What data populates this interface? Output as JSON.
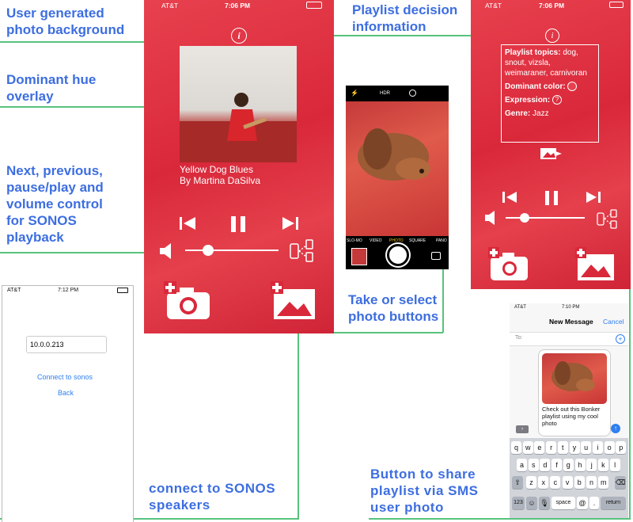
{
  "labels": {
    "photo_bg": "User generated photo background",
    "hue": "Dominant hue overlay",
    "controls": "Next, previous, pause/play and volume control for SONOS playback",
    "decision": "Playlist decision information",
    "take_select": "Take or select photo buttons",
    "connect": "connect to SONOS speakers",
    "share": "Button to share playlist via SMS user photo"
  },
  "main_phone": {
    "carrier": "AT&T",
    "time": "7:06 PM",
    "song_title": "Yellow Dog Blues",
    "song_artist": "By Martina DaSilva"
  },
  "connect_phone": {
    "carrier": "AT&T",
    "time": "7:12 PM",
    "ip_value": "10.0.0.213",
    "connect_label": "Connect to sonos",
    "back_label": "Back"
  },
  "camera_phone": {
    "hdr_label": "HDR",
    "modes": [
      "SLO-MO",
      "VIDEO",
      "PHOTO",
      "SQUARE",
      "PANO"
    ]
  },
  "info_phone": {
    "carrier": "AT&T",
    "time": "7:06 PM",
    "topics_label": "Playlist topics:",
    "topics_value": "dog, snout, vizsla, weimaraner, carnivoran",
    "color_label": "Dominant color:",
    "expression_label": "Expression:",
    "genre_label": "Genre:",
    "genre_value": "Jazz",
    "dominant_color": "#e8414e"
  },
  "sms_phone": {
    "carrier": "AT&T",
    "time": "7:10 PM",
    "title": "New Message",
    "cancel": "Cancel",
    "to_label": "To:",
    "message": "Check out this Bonker playlist using my cool photo",
    "keys_row1": [
      "q",
      "w",
      "e",
      "r",
      "t",
      "y",
      "u",
      "i",
      "o",
      "p"
    ],
    "keys_row2": [
      "a",
      "s",
      "d",
      "f",
      "g",
      "h",
      "j",
      "k",
      "l"
    ],
    "keys_row3": [
      "z",
      "x",
      "c",
      "v",
      "b",
      "n",
      "m"
    ],
    "key_123": "123",
    "key_space": "space",
    "key_at": "@",
    "key_dot": ".",
    "key_return": "return"
  },
  "colors": {
    "accent_blue": "#3d6ee0",
    "line_green": "#58c27d",
    "overlay_red": "#e8414e"
  }
}
